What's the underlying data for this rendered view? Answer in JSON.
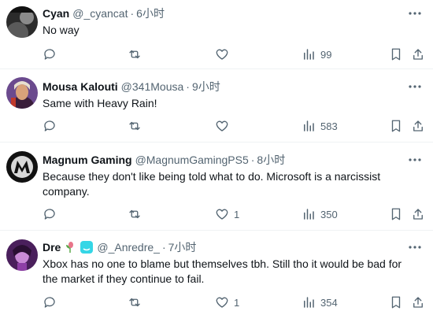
{
  "tweets": [
    {
      "name": "Cyan",
      "handle": "@_cyancat",
      "separator": "·",
      "time": "6小时",
      "text": [
        "No way"
      ],
      "likes": "",
      "views": "99"
    },
    {
      "name": "Mousa Kalouti",
      "handle": "@341Mousa",
      "separator": "·",
      "time": "9小时",
      "text": [
        "Same with Heavy Rain!"
      ],
      "likes": "",
      "views": "583"
    },
    {
      "name": "Magnum Gaming",
      "handle": "@MagnumGamingPS5",
      "separator": "·",
      "time": "8小时",
      "text": [
        "Because they don't like being told what to do. Microsoft is a narcissist",
        "company."
      ],
      "likes": "1",
      "views": "350"
    },
    {
      "name": "Dre",
      "handle": "@_Anredre_",
      "separator": "·",
      "time": "7小时",
      "text": [
        "Xbox has no one to blame but themselves tbh. Still tho it would be bad for",
        "the market if they continue to fail."
      ],
      "likes": "1",
      "views": "354"
    }
  ],
  "colors": {
    "text": "#0f1419",
    "secondary": "#536471",
    "divider": "#eff3f4"
  }
}
